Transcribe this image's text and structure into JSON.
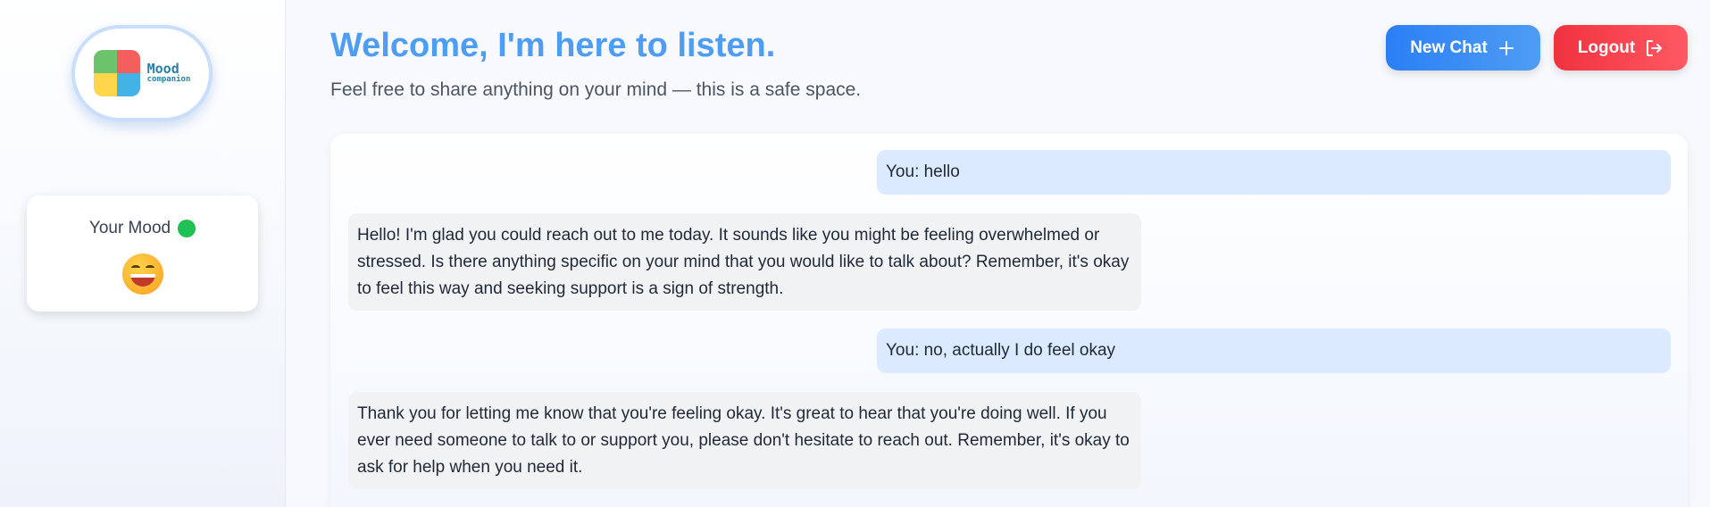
{
  "sidebar": {
    "logo": {
      "line1": "Mood",
      "line2": "companion"
    },
    "mood": {
      "title": "Your Mood",
      "status_color": "#1fc155",
      "emoji": "grinning-face"
    }
  },
  "header": {
    "title": "Welcome, I'm here to listen.",
    "subtitle": "Feel free to share anything on your mind — this is a safe space.",
    "new_chat_label": "New Chat",
    "logout_label": "Logout"
  },
  "chat": {
    "messages": [
      {
        "role": "user",
        "text": "You: hello"
      },
      {
        "role": "bot",
        "text": "Hello! I'm glad you could reach out to me today. It sounds like you might be feeling overwhelmed or stressed. Is there anything specific on your mind that you would like to talk about? Remember, it's okay to feel this way and seeking support is a sign of strength."
      },
      {
        "role": "user",
        "text": "You: no, actually I do feel okay"
      },
      {
        "role": "bot",
        "text": "Thank you for letting me know that you're feeling okay. It's great to hear that you're doing well. If you ever need someone to talk to or support you, please don't hesitate to reach out. Remember, it's okay to ask for help when you need it."
      }
    ]
  },
  "colors": {
    "accent": "#4d9df4",
    "new_chat": "#2b7ff5",
    "logout": "#f0323f",
    "user_bubble": "#dbeafe",
    "bot_bubble": "#f1f2f4"
  }
}
